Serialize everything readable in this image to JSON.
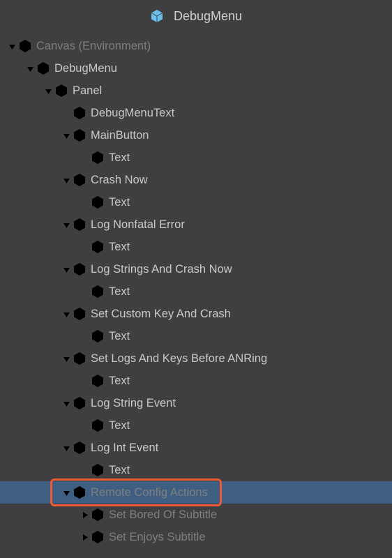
{
  "header": {
    "title": "DebugMenu"
  },
  "tree": {
    "root": {
      "label": "Canvas (Environment)",
      "children": [
        {
          "label": "DebugMenu",
          "children": [
            {
              "label": "Panel",
              "children": [
                {
                  "label": "DebugMenuText",
                  "leaf": true
                },
                {
                  "label": "MainButton",
                  "children": [
                    {
                      "label": "Text",
                      "leaf": true
                    }
                  ]
                },
                {
                  "label": "Crash Now",
                  "children": [
                    {
                      "label": "Text",
                      "leaf": true
                    }
                  ]
                },
                {
                  "label": "Log Nonfatal Error",
                  "children": [
                    {
                      "label": "Text",
                      "leaf": true
                    }
                  ]
                },
                {
                  "label": "Log Strings And Crash Now",
                  "children": [
                    {
                      "label": "Text",
                      "leaf": true
                    }
                  ]
                },
                {
                  "label": "Set Custom Key And Crash",
                  "children": [
                    {
                      "label": "Text",
                      "leaf": true
                    }
                  ]
                },
                {
                  "label": "Set Logs And Keys Before ANRing",
                  "children": [
                    {
                      "label": "Text",
                      "leaf": true
                    }
                  ]
                },
                {
                  "label": "Log String Event",
                  "children": [
                    {
                      "label": "Text",
                      "leaf": true
                    }
                  ]
                },
                {
                  "label": "Log Int Event",
                  "children": [
                    {
                      "label": "Text",
                      "leaf": true
                    }
                  ]
                },
                {
                  "label": "Remote Config Actions",
                  "selected": true,
                  "highlighted": true,
                  "dim": true,
                  "children": [
                    {
                      "label": "Set Bored Of Subtitle",
                      "collapsed": true,
                      "dim": true
                    },
                    {
                      "label": "Set Enjoys Subtitle",
                      "collapsed": true,
                      "dim": true
                    }
                  ]
                }
              ]
            }
          ]
        }
      ]
    }
  }
}
